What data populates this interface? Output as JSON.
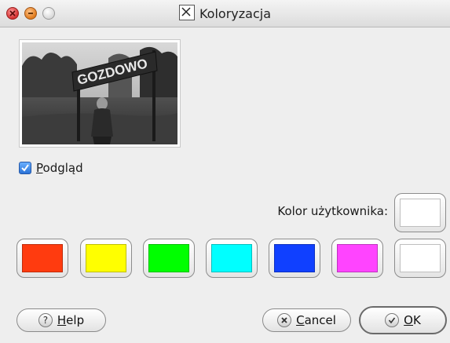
{
  "window": {
    "title": "Koloryzacja",
    "controls": [
      "close-icon",
      "minimize-icon",
      "maximize-icon"
    ]
  },
  "preview": {
    "sign_text": "GOZDOWO"
  },
  "checkbox": {
    "label_accel": "P",
    "label_rest": "odgląd",
    "checked": true
  },
  "user_color": {
    "label": "Kolor użytkownika:",
    "color": "#ffffff"
  },
  "swatches": [
    {
      "color": "#ff3b0f"
    },
    {
      "color": "#ffff00"
    },
    {
      "color": "#00ff00"
    },
    {
      "color": "#00ffff"
    },
    {
      "color": "#1040ff"
    },
    {
      "color": "#ff44ff"
    },
    {
      "color": "#ffffff"
    }
  ],
  "buttons": {
    "help_accel": "H",
    "help_rest": "elp",
    "help_icon": "?",
    "cancel_accel": "C",
    "cancel_rest": "ancel",
    "ok_accel": "O",
    "ok_rest": "K"
  }
}
